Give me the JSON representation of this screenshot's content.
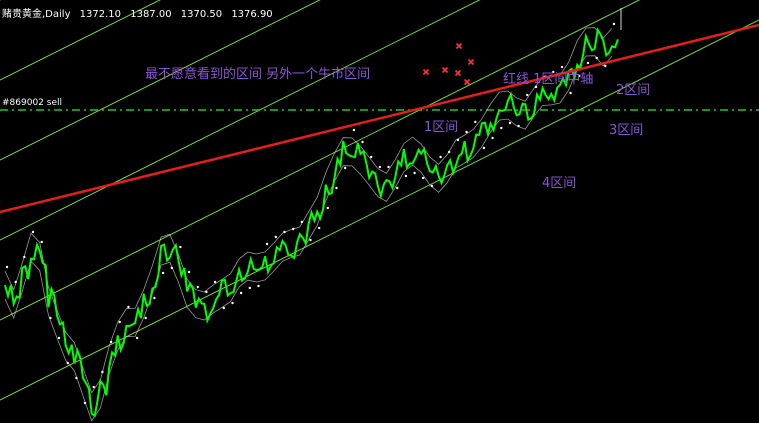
{
  "header": {
    "symbol": "赌贵黄金,Daily",
    "open": "1372.10",
    "high": "1387.00",
    "low": "1370.50",
    "close": "1376.90"
  },
  "order_level": "#869002 sell",
  "annotations": {
    "main_note": "最不愿意看到的区间 另外一个牛市区间",
    "red_line_note": "红线 1区间中轴",
    "zone_1": "1区间",
    "zone_2": "2区间",
    "zone_3": "3区间",
    "zone_4": "4区间"
  },
  "colors": {
    "background": "#000000",
    "price": "#00ff00",
    "channel": "#7fd63a",
    "red_line": "#e0201a",
    "level_line": "#2fbf2f",
    "text": "#8a55d6",
    "marker": "#ff3030",
    "envelope": "#d8d8d8",
    "sar": "#ffffff"
  },
  "chart_data": {
    "type": "line",
    "title": "",
    "xlabel": "",
    "ylabel": "",
    "ylim": [
      0,
      423
    ],
    "series": [
      {
        "values": [
          285,
          300,
          275,
          250,
          260,
          300,
          320,
          345,
          360,
          385,
          405,
          390,
          360,
          340,
          325,
          320,
          300,
          280,
          255,
          250,
          265,
          290,
          305,
          310,
          300,
          290,
          285,
          275,
          270,
          268,
          262,
          255,
          250,
          247,
          240,
          222,
          210,
          190,
          170,
          150,
          148,
          160,
          175,
          185,
          185,
          170,
          158,
          155,
          160,
          168,
          175,
          170,
          158,
          150,
          140,
          130,
          120,
          110,
          105,
          108,
          113,
          105,
          95,
          90,
          85,
          75,
          58,
          45,
          40,
          48,
          42
        ]
      }
    ]
  }
}
